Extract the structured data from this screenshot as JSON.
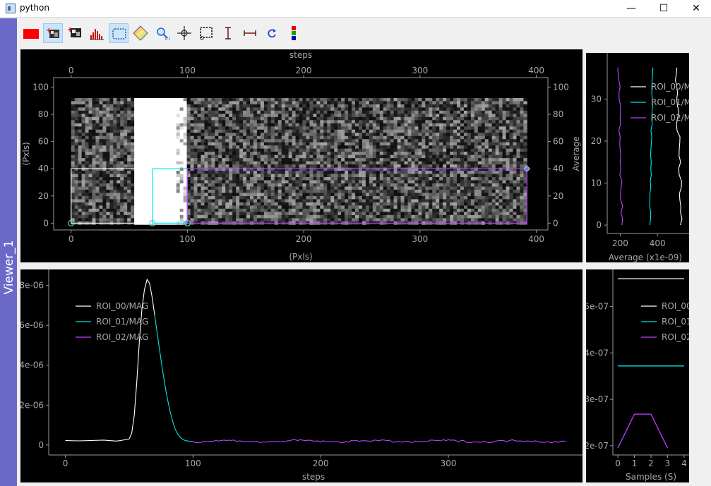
{
  "window": {
    "title": "python",
    "minimize": "—",
    "maximize": "☐",
    "close": "✕"
  },
  "sidebar": {
    "label": "Viewer_1"
  },
  "toolbar": {
    "tools": [
      {
        "icon": "red-rectangle-icon"
      },
      {
        "icon": "add-image-roi-icon"
      },
      {
        "icon": "image-icon"
      },
      {
        "icon": "histogram-icon"
      },
      {
        "icon": "rectangle-roi-icon"
      },
      {
        "icon": "colormap-icon"
      },
      {
        "icon": "zoom-icon"
      },
      {
        "icon": "crosshair-icon"
      },
      {
        "icon": "crop-icon"
      },
      {
        "icon": "vertical-range-icon"
      },
      {
        "icon": "horizontal-range-icon"
      },
      {
        "icon": "refresh-icon"
      },
      {
        "icon": "color-bars-icon"
      }
    ]
  },
  "colors": {
    "roi_00": "#ffffff",
    "roi_01": "#00e5e5",
    "roi_02": "#c040ff",
    "sidebar": "#6b69c8"
  },
  "chart_data": [
    {
      "name": "image-2d",
      "type": "heatmap",
      "title": "",
      "xlabel_top": "steps",
      "xlabel": "(Pxls)",
      "ylabel": "(Pxls)",
      "ylabel_right": "Average",
      "x_ticks": [
        "0",
        "100",
        "200",
        "300",
        "400"
      ],
      "y_ticks": [
        "0",
        "20",
        "40",
        "60",
        "80",
        "100"
      ],
      "y_ticks_right": [
        "0",
        "20",
        "40",
        "60",
        "80",
        "100"
      ],
      "xlim": [
        -15,
        410
      ],
      "ylim": [
        -5,
        107
      ],
      "image_extent": {
        "x": [
          0,
          392
        ],
        "y": [
          -1,
          92
        ]
      },
      "rois": [
        {
          "name": "ROI_00",
          "x": [
            0,
            55
          ],
          "y": [
            0,
            40
          ]
        },
        {
          "name": "ROI_01",
          "x": [
            70,
            100
          ],
          "y": [
            0,
            40
          ]
        },
        {
          "name": "ROI_02",
          "x": [
            100,
            392
          ],
          "y": [
            0,
            40
          ]
        }
      ]
    },
    {
      "name": "lineout-vertical",
      "type": "line",
      "xlabel": "Average (x1e-09)",
      "x_ticks": [
        "200",
        "400"
      ],
      "y_ticks": [
        "0",
        "10",
        "20",
        "30"
      ],
      "xlim": [
        130,
        570
      ],
      "ylim": [
        -2,
        41
      ],
      "legend": [
        "ROI_00/M",
        "ROI_01/M",
        "ROI_02/M"
      ],
      "series": [
        {
          "name": "ROI_00/M",
          "centers": [
            530,
            500,
            520
          ]
        },
        {
          "name": "ROI_01/M",
          "centers": [
            360,
            375,
            370
          ]
        },
        {
          "name": "ROI_02/M",
          "centers": [
            210,
            190,
            205
          ]
        }
      ]
    },
    {
      "name": "lineout-time",
      "type": "line",
      "xlabel": "steps",
      "x_ticks": [
        "0",
        "100",
        "200",
        "300"
      ],
      "y_ticks": [
        "0",
        "2e-06",
        "4e-06",
        "6e-06",
        "8e-06"
      ],
      "xlim": [
        -13,
        405
      ],
      "ylim": [
        -5e-07,
        8.8e-06
      ],
      "legend": [
        "ROI_00/MAG",
        "ROI_01/MAG",
        "ROI_02/MAG"
      ],
      "series": [
        {
          "name": "ROI_00/MAG",
          "x": [
            0,
            10,
            20,
            30,
            40,
            45,
            50,
            52,
            54,
            56,
            58,
            60,
            62,
            64,
            66,
            68,
            70
          ],
          "y": [
            2.3e-07,
            2.2e-07,
            2.4e-07,
            2.2e-07,
            2.3e-07,
            2.4e-07,
            3e-07,
            6e-07,
            1.5e-06,
            3.2e-06,
            5.2e-06,
            6.8e-06,
            7.8e-06,
            8.3e-06,
            8.1e-06,
            7.4e-06,
            6.5e-06
          ]
        },
        {
          "name": "ROI_01/MAG",
          "x": [
            70,
            72,
            74,
            76,
            78,
            80,
            82,
            84,
            86,
            88,
            90,
            92,
            94,
            96,
            98,
            100
          ],
          "y": [
            6.5e-06,
            5.6e-06,
            4.7e-06,
            3.8e-06,
            3e-06,
            2.3e-06,
            1.7e-06,
            1.2e-06,
            8e-07,
            5.5e-07,
            3.8e-07,
            2.8e-07,
            2.2e-07,
            2e-07,
            1.8e-07,
            1.8e-07
          ]
        },
        {
          "name": "ROI_02/MAG",
          "x": [
            100,
            392
          ],
          "y": [
            1.9e-07,
            1.9e-07
          ]
        }
      ]
    },
    {
      "name": "lineout-samples",
      "type": "line",
      "xlabel": "Samples (S)",
      "x_ticks": [
        "0",
        "1",
        "2",
        "3",
        "4"
      ],
      "y_ticks": [
        "2e-07",
        "3e-07",
        "4e-07",
        "5e-07"
      ],
      "xlim": [
        -0.3,
        4.3
      ],
      "ylim": [
        1.8e-07,
        5.8e-07
      ],
      "legend": [
        "ROI_00",
        "ROI_01",
        "ROI_02"
      ],
      "series": [
        {
          "name": "ROI_00",
          "x": [
            0,
            4
          ],
          "y": [
            5.6e-07,
            5.6e-07
          ]
        },
        {
          "name": "ROI_01",
          "x": [
            0,
            4
          ],
          "y": [
            3.72e-07,
            3.72e-07
          ]
        },
        {
          "name": "ROI_02",
          "x": [
            0,
            1,
            2,
            3
          ],
          "y": [
            1.95e-07,
            2.68e-07,
            2.68e-07,
            1.95e-07
          ]
        }
      ]
    }
  ]
}
